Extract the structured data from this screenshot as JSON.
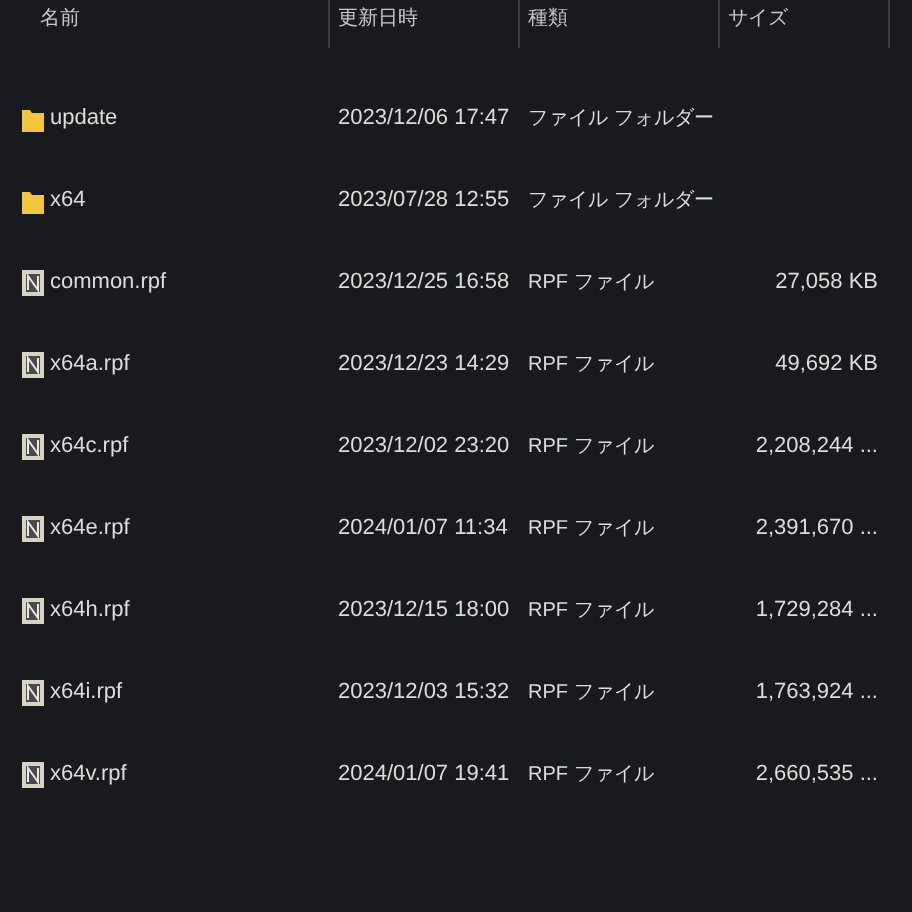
{
  "columns": [
    "名前",
    "更新日時",
    "種類",
    "サイズ"
  ],
  "rows": [
    {
      "kind": "folder",
      "name": "update",
      "modified": "2023/12/06 17:47",
      "type": "ファイル フォルダー"
    },
    {
      "kind": "folder",
      "name": "x64",
      "modified": "2023/07/28 12:55",
      "type": "ファイル フォルダー"
    },
    {
      "kind": "file",
      "name": "common.rpf",
      "modified": "2023/12/25 16:58",
      "type": "RPF ファイル",
      "size": "27,058 KB"
    },
    {
      "kind": "file",
      "name": "x64a.rpf",
      "modified": "2023/12/23 14:29",
      "type": "RPF ファイル",
      "size": "49,692 KB"
    },
    {
      "kind": "file",
      "name": "x64c.rpf",
      "modified": "2023/12/02 23:20",
      "type": "RPF ファイル",
      "size": "2,208,244 ..."
    },
    {
      "kind": "file",
      "name": "x64e.rpf",
      "modified": "2024/01/07 11:34",
      "type": "RPF ファイル",
      "size": "2,391,670 ..."
    },
    {
      "kind": "file",
      "name": "x64h.rpf",
      "modified": "2023/12/15 18:00",
      "type": "RPF ファイル",
      "size": "1,729,284 ..."
    },
    {
      "kind": "file",
      "name": "x64i.rpf",
      "modified": "2023/12/03 15:32",
      "type": "RPF ファイル",
      "size": "1,763,924 ..."
    },
    {
      "kind": "file",
      "name": "x64v.rpf",
      "modified": "2024/01/07 19:41",
      "type": "RPF ファイル",
      "size": "2,660,535 ..."
    }
  ]
}
